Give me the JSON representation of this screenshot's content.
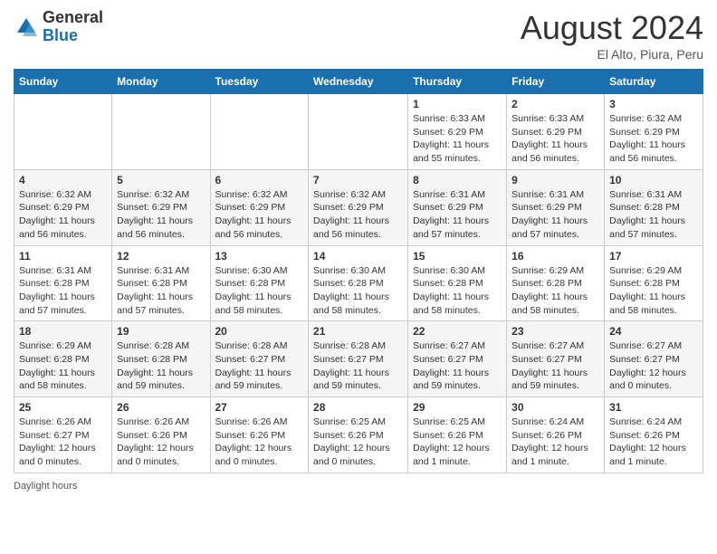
{
  "logo": {
    "general": "General",
    "blue": "Blue"
  },
  "title": "August 2024",
  "subtitle": "El Alto, Piura, Peru",
  "days_of_week": [
    "Sunday",
    "Monday",
    "Tuesday",
    "Wednesday",
    "Thursday",
    "Friday",
    "Saturday"
  ],
  "footer": "Daylight hours",
  "weeks": [
    [
      {
        "day": "",
        "info": ""
      },
      {
        "day": "",
        "info": ""
      },
      {
        "day": "",
        "info": ""
      },
      {
        "day": "",
        "info": ""
      },
      {
        "day": "1",
        "info": "Sunrise: 6:33 AM\nSunset: 6:29 PM\nDaylight: 11 hours and 55 minutes."
      },
      {
        "day": "2",
        "info": "Sunrise: 6:33 AM\nSunset: 6:29 PM\nDaylight: 11 hours and 56 minutes."
      },
      {
        "day": "3",
        "info": "Sunrise: 6:32 AM\nSunset: 6:29 PM\nDaylight: 11 hours and 56 minutes."
      }
    ],
    [
      {
        "day": "4",
        "info": "Sunrise: 6:32 AM\nSunset: 6:29 PM\nDaylight: 11 hours and 56 minutes."
      },
      {
        "day": "5",
        "info": "Sunrise: 6:32 AM\nSunset: 6:29 PM\nDaylight: 11 hours and 56 minutes."
      },
      {
        "day": "6",
        "info": "Sunrise: 6:32 AM\nSunset: 6:29 PM\nDaylight: 11 hours and 56 minutes."
      },
      {
        "day": "7",
        "info": "Sunrise: 6:32 AM\nSunset: 6:29 PM\nDaylight: 11 hours and 56 minutes."
      },
      {
        "day": "8",
        "info": "Sunrise: 6:31 AM\nSunset: 6:29 PM\nDaylight: 11 hours and 57 minutes."
      },
      {
        "day": "9",
        "info": "Sunrise: 6:31 AM\nSunset: 6:29 PM\nDaylight: 11 hours and 57 minutes."
      },
      {
        "day": "10",
        "info": "Sunrise: 6:31 AM\nSunset: 6:28 PM\nDaylight: 11 hours and 57 minutes."
      }
    ],
    [
      {
        "day": "11",
        "info": "Sunrise: 6:31 AM\nSunset: 6:28 PM\nDaylight: 11 hours and 57 minutes."
      },
      {
        "day": "12",
        "info": "Sunrise: 6:31 AM\nSunset: 6:28 PM\nDaylight: 11 hours and 57 minutes."
      },
      {
        "day": "13",
        "info": "Sunrise: 6:30 AM\nSunset: 6:28 PM\nDaylight: 11 hours and 58 minutes."
      },
      {
        "day": "14",
        "info": "Sunrise: 6:30 AM\nSunset: 6:28 PM\nDaylight: 11 hours and 58 minutes."
      },
      {
        "day": "15",
        "info": "Sunrise: 6:30 AM\nSunset: 6:28 PM\nDaylight: 11 hours and 58 minutes."
      },
      {
        "day": "16",
        "info": "Sunrise: 6:29 AM\nSunset: 6:28 PM\nDaylight: 11 hours and 58 minutes."
      },
      {
        "day": "17",
        "info": "Sunrise: 6:29 AM\nSunset: 6:28 PM\nDaylight: 11 hours and 58 minutes."
      }
    ],
    [
      {
        "day": "18",
        "info": "Sunrise: 6:29 AM\nSunset: 6:28 PM\nDaylight: 11 hours and 58 minutes."
      },
      {
        "day": "19",
        "info": "Sunrise: 6:28 AM\nSunset: 6:28 PM\nDaylight: 11 hours and 59 minutes."
      },
      {
        "day": "20",
        "info": "Sunrise: 6:28 AM\nSunset: 6:27 PM\nDaylight: 11 hours and 59 minutes."
      },
      {
        "day": "21",
        "info": "Sunrise: 6:28 AM\nSunset: 6:27 PM\nDaylight: 11 hours and 59 minutes."
      },
      {
        "day": "22",
        "info": "Sunrise: 6:27 AM\nSunset: 6:27 PM\nDaylight: 11 hours and 59 minutes."
      },
      {
        "day": "23",
        "info": "Sunrise: 6:27 AM\nSunset: 6:27 PM\nDaylight: 11 hours and 59 minutes."
      },
      {
        "day": "24",
        "info": "Sunrise: 6:27 AM\nSunset: 6:27 PM\nDaylight: 12 hours and 0 minutes."
      }
    ],
    [
      {
        "day": "25",
        "info": "Sunrise: 6:26 AM\nSunset: 6:27 PM\nDaylight: 12 hours and 0 minutes."
      },
      {
        "day": "26",
        "info": "Sunrise: 6:26 AM\nSunset: 6:26 PM\nDaylight: 12 hours and 0 minutes."
      },
      {
        "day": "27",
        "info": "Sunrise: 6:26 AM\nSunset: 6:26 PM\nDaylight: 12 hours and 0 minutes."
      },
      {
        "day": "28",
        "info": "Sunrise: 6:25 AM\nSunset: 6:26 PM\nDaylight: 12 hours and 0 minutes."
      },
      {
        "day": "29",
        "info": "Sunrise: 6:25 AM\nSunset: 6:26 PM\nDaylight: 12 hours and 1 minute."
      },
      {
        "day": "30",
        "info": "Sunrise: 6:24 AM\nSunset: 6:26 PM\nDaylight: 12 hours and 1 minute."
      },
      {
        "day": "31",
        "info": "Sunrise: 6:24 AM\nSunset: 6:26 PM\nDaylight: 12 hours and 1 minute."
      }
    ]
  ]
}
